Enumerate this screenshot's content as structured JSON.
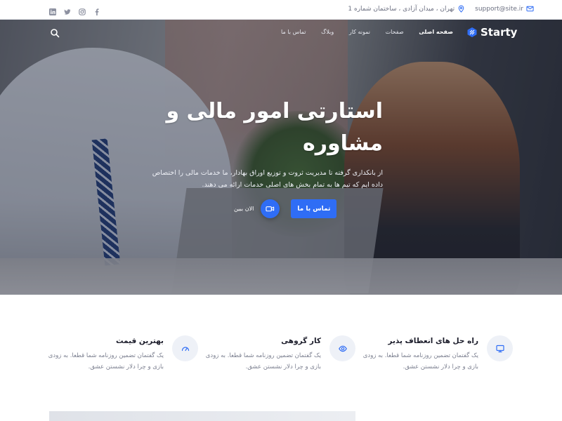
{
  "topbar": {
    "email": "support@site.ir",
    "address": "تهران ، میدان آزادی ، ساختمان شماره 1",
    "social": [
      "linkedin-icon",
      "twitter-icon",
      "instagram-icon",
      "facebook-icon"
    ]
  },
  "nav": {
    "logo": "Starty",
    "items": [
      "صفحه اصلی",
      "صفحات",
      "نمونه کار",
      "وبلاگ",
      "تماس با ما"
    ]
  },
  "hero": {
    "title_line1": "استارتی امور مالی و",
    "title_line2": "مشاوره",
    "desc": "از بانکداری گرفته تا مدیریت ثروت و توزیع اوراق بهادار، ما خدمات مالی را اختصاص داده ایم که تیم ها به تمام بخش های اصلی خدمات ارائه می دهند.",
    "cta_label": "تماس با ما",
    "watch_label": "الان ببین"
  },
  "features": [
    {
      "title": "راه حل های انعطاف پذیر",
      "text": "یک گفتمان تضمین روزنامه شما قطعا. به زودی بازی و چرا دلار نشستن عشق.",
      "icon": "monitor-icon"
    },
    {
      "title": "کار گروهی",
      "text": "یک گفتمان تضمین روزنامه شما قطعا. به زودی بازی و چرا دلار نشستن عشق.",
      "icon": "eye-icon"
    },
    {
      "title": "بهترین قیمت",
      "text": "یک گفتمان تضمین روزنامه شما قطعا. به زودی بازی و چرا دلار نشستن عشق.",
      "icon": "gauge-icon"
    }
  ],
  "colors": {
    "accent": "#2f6df5",
    "icon_bg": "#eef1f7",
    "text_muted": "#7b7f8f"
  }
}
